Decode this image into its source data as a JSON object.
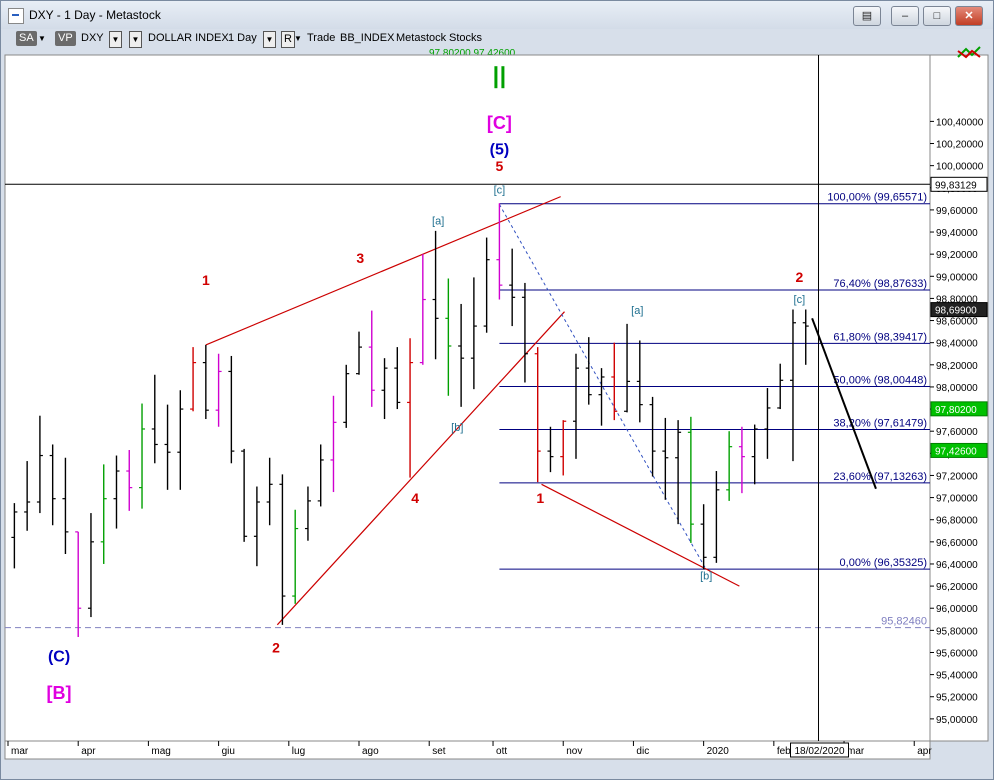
{
  "window": {
    "title": "DXY - 1 Day - Metastock",
    "minimize_label": "–",
    "restore_label": "□",
    "close_label": "✕",
    "help_label": "▤"
  },
  "toolbar": {
    "sa": "SA",
    "vp": "VP",
    "symbol": "DXY",
    "name": "DOLLAR INDEX",
    "period": "1 Day",
    "rmode": "R",
    "mode": "Trade",
    "datasource": "BB_INDEX",
    "vendor": "Metastock",
    "instrument": "Stocks",
    "ma_values": "97,80200  97,42600"
  },
  "colors": {
    "background": "#ffffff",
    "bar_black": "#000000",
    "bar_green": "#00a000",
    "bar_red": "#d00000",
    "bar_magenta": "#d000d0",
    "fib_line": "#000080",
    "trend_line": "#cc0000",
    "label_red": "#d00000",
    "label_blue": "#0000c0",
    "label_magenta": "#e000e0",
    "label_teal": "#207090",
    "label_green": "#00a000"
  },
  "chart_data": {
    "type": "candlestick",
    "title": "",
    "xlabel": "",
    "ylabel": "",
    "ylim": [
      94.8,
      101.0
    ],
    "x_ticks": [
      "mar",
      "apr",
      "mag",
      "giu",
      "lug",
      "ago",
      "set",
      "ott",
      "nov",
      "dic",
      "2020",
      "feb",
      "mar",
      "apr"
    ],
    "y_ticks": [
      "100,40000",
      "100,20000",
      "100,00000",
      "99,80000",
      "99,60000",
      "99,40000",
      "99,20000",
      "99,00000",
      "98,80000",
      "98,60000",
      "98,40000",
      "98,20000",
      "98,00000",
      "97,80000",
      "97,60000",
      "97,40000",
      "97,20000",
      "97,00000",
      "96,80000",
      "96,60000",
      "96,40000",
      "96,20000",
      "96,00000",
      "95,80000",
      "95,60000",
      "95,40000",
      "95,20000",
      "95,00000"
    ],
    "price_badges": [
      {
        "value": 99.83129,
        "text": "99,83129",
        "style": "box"
      },
      {
        "value": 98.699,
        "text": "98,69900",
        "style": "dark"
      },
      {
        "value": 97.802,
        "text": "97,80200",
        "style": "green"
      },
      {
        "value": 97.426,
        "text": "97,42600",
        "style": "green"
      }
    ],
    "cursor_date": "18/02/2020",
    "fib_levels": [
      {
        "pct": "100,00%",
        "value": 99.65571,
        "label": "100,00% (99,65571)"
      },
      {
        "pct": "76,40%",
        "value": 98.87633,
        "label": "76,40% (98,87633)"
      },
      {
        "pct": "61,80%",
        "value": 98.39417,
        "label": "61,80% (98,39417)"
      },
      {
        "pct": "50,00%",
        "value": 98.00448,
        "label": "50,00% (98,00448)"
      },
      {
        "pct": "38,20%",
        "value": 97.61479,
        "label": "38,20% (97,61479)"
      },
      {
        "pct": "23,60%",
        "value": 97.13263,
        "label": "23,60% (97,13263)"
      },
      {
        "pct": "0,00%",
        "value": 96.35325,
        "label": "0,00% (96,35325)"
      }
    ],
    "reference_lines": [
      {
        "value": 99.83129,
        "style": "solid"
      },
      {
        "value": 95.8246,
        "style": "dashed",
        "label": "95,82460"
      }
    ],
    "wave_labels": [
      {
        "text": "(C)",
        "date": 3.5,
        "value": 95.52,
        "color": "blue"
      },
      {
        "text": "[B]",
        "date": 3.5,
        "value": 95.18,
        "color": "magenta"
      },
      {
        "text": "1",
        "date": 15.0,
        "value": 98.92,
        "color": "red"
      },
      {
        "text": "2",
        "date": 20.5,
        "value": 95.6,
        "color": "red"
      },
      {
        "text": "3",
        "date": 27.1,
        "value": 99.12,
        "color": "red"
      },
      {
        "text": "4",
        "date": 31.4,
        "value": 96.95,
        "color": "red"
      },
      {
        "text": "[a]",
        "date": 33.2,
        "value": 99.47,
        "color": "teal"
      },
      {
        "text": "[b]",
        "date": 34.7,
        "value": 97.6,
        "color": "teal"
      },
      {
        "text": "[c]",
        "date": 38.0,
        "value": 99.75,
        "color": "teal"
      },
      {
        "text": "5",
        "date": 38.0,
        "value": 99.95,
        "color": "red"
      },
      {
        "text": "(5)",
        "date": 38.0,
        "value": 100.1,
        "color": "blue"
      },
      {
        "text": "[C]",
        "date": 38.0,
        "value": 100.33,
        "color": "magenta"
      },
      {
        "text": "1",
        "date": 41.2,
        "value": 96.95,
        "color": "red"
      },
      {
        "text": "[a]",
        "date": 48.8,
        "value": 98.66,
        "color": "teal"
      },
      {
        "text": "[b]",
        "date": 54.2,
        "value": 96.26,
        "color": "teal"
      },
      {
        "text": "2",
        "date": 61.5,
        "value": 98.95,
        "color": "red"
      },
      {
        "text": "[c]",
        "date": 61.5,
        "value": 98.76,
        "color": "teal"
      }
    ],
    "top_marker": {
      "date": 38.0,
      "color": "green"
    },
    "trend_lines": [
      {
        "from": [
          15.0,
          98.38
        ],
        "to": [
          42.8,
          99.72
        ]
      },
      {
        "from": [
          20.6,
          95.85
        ],
        "to": [
          43.1,
          98.68
        ]
      },
      {
        "from": [
          41.3,
          97.12
        ],
        "to": [
          56.8,
          96.2
        ]
      }
    ],
    "dashed_lines": [
      {
        "from": [
          38.0,
          99.65
        ],
        "to": [
          54.2,
          96.35
        ]
      }
    ],
    "projection_line": {
      "from": [
        62.5,
        98.62
      ],
      "to": [
        67.5,
        97.08
      ]
    },
    "cursor_line": {
      "date": 63.0
    },
    "n_bars": 63,
    "bars": [
      [
        96.64,
        96.95,
        96.36,
        96.87
      ],
      [
        96.87,
        97.33,
        96.7,
        96.96
      ],
      [
        96.96,
        97.74,
        96.86,
        97.38
      ],
      [
        97.38,
        97.48,
        96.75,
        96.99
      ],
      [
        96.99,
        97.36,
        96.49,
        96.69
      ],
      [
        96.69,
        96.69,
        95.74,
        96.0
      ],
      [
        96.0,
        96.86,
        95.92,
        96.6
      ],
      [
        96.6,
        97.3,
        96.4,
        96.99
      ],
      [
        96.99,
        97.38,
        96.72,
        97.24
      ],
      [
        97.24,
        97.43,
        96.88,
        97.09
      ],
      [
        97.09,
        97.85,
        96.9,
        97.62
      ],
      [
        97.62,
        98.11,
        97.31,
        97.48
      ],
      [
        97.48,
        97.84,
        97.07,
        97.41
      ],
      [
        97.41,
        97.97,
        97.07,
        97.8
      ],
      [
        97.8,
        98.36,
        97.78,
        98.22
      ],
      [
        98.22,
        98.38,
        97.71,
        97.79
      ],
      [
        97.79,
        98.3,
        97.64,
        98.14
      ],
      [
        98.14,
        98.28,
        97.31,
        97.42
      ],
      [
        97.42,
        97.44,
        96.6,
        96.65
      ],
      [
        96.65,
        97.1,
        96.38,
        96.96
      ],
      [
        96.96,
        97.36,
        96.75,
        97.12
      ],
      [
        97.12,
        97.21,
        95.85,
        96.11
      ],
      [
        96.11,
        96.89,
        96.04,
        96.72
      ],
      [
        96.72,
        97.1,
        96.61,
        96.97
      ],
      [
        96.97,
        97.48,
        96.92,
        97.34
      ],
      [
        97.34,
        97.92,
        97.05,
        97.68
      ],
      [
        97.68,
        98.2,
        97.63,
        98.12
      ],
      [
        98.12,
        98.5,
        98.11,
        98.36
      ],
      [
        98.36,
        98.69,
        97.82,
        97.97
      ],
      [
        97.97,
        98.26,
        97.71,
        98.17
      ],
      [
        98.17,
        98.36,
        97.8,
        97.86
      ],
      [
        97.86,
        98.44,
        97.18,
        98.22
      ],
      [
        98.22,
        99.2,
        98.2,
        98.79
      ],
      [
        98.79,
        99.41,
        98.25,
        98.62
      ],
      [
        98.62,
        98.98,
        97.92,
        98.37
      ],
      [
        98.37,
        98.75,
        97.82,
        98.26
      ],
      [
        98.26,
        98.99,
        97.98,
        98.55
      ],
      [
        98.55,
        99.35,
        98.49,
        99.15
      ],
      [
        99.15,
        99.66,
        98.79,
        98.92
      ],
      [
        98.92,
        99.25,
        98.55,
        98.81
      ],
      [
        98.81,
        98.94,
        98.04,
        98.3
      ],
      [
        98.3,
        98.36,
        97.14,
        97.42
      ],
      [
        97.42,
        97.64,
        97.23,
        97.37
      ],
      [
        97.37,
        97.7,
        97.2,
        97.69
      ],
      [
        97.69,
        98.3,
        97.35,
        98.17
      ],
      [
        98.17,
        98.45,
        97.84,
        97.93
      ],
      [
        97.93,
        98.17,
        97.65,
        98.09
      ],
      [
        98.09,
        98.4,
        97.7,
        97.78
      ],
      [
        97.78,
        98.57,
        97.77,
        98.05
      ],
      [
        98.05,
        98.42,
        97.68,
        97.84
      ],
      [
        97.84,
        97.91,
        97.19,
        97.42
      ],
      [
        97.42,
        97.72,
        96.98,
        97.36
      ],
      [
        97.36,
        97.7,
        96.76,
        97.59
      ],
      [
        97.59,
        97.73,
        96.59,
        96.76
      ],
      [
        96.76,
        96.94,
        96.35,
        96.46
      ],
      [
        96.46,
        97.24,
        96.41,
        97.07
      ],
      [
        97.07,
        97.6,
        96.97,
        97.46
      ],
      [
        97.46,
        97.64,
        97.04,
        97.37
      ],
      [
        97.37,
        97.66,
        97.12,
        97.62
      ],
      [
        97.62,
        97.99,
        97.35,
        97.81
      ],
      [
        97.81,
        98.21,
        97.8,
        98.06
      ],
      [
        98.06,
        98.7,
        97.33,
        98.58
      ],
      [
        98.58,
        98.7,
        98.2,
        98.55
      ]
    ],
    "bar_colors": [
      "black",
      "black",
      "black",
      "black",
      "black",
      "magenta",
      "black",
      "green",
      "black",
      "magenta",
      "green",
      "black",
      "black",
      "black",
      "red",
      "black",
      "magenta",
      "black",
      "black",
      "black",
      "black",
      "black",
      "green",
      "black",
      "black",
      "magenta",
      "black",
      "black",
      "magenta",
      "black",
      "black",
      "red",
      "magenta",
      "black",
      "green",
      "black",
      "black",
      "black",
      "magenta",
      "black",
      "black",
      "red",
      "black",
      "red",
      "black",
      "black",
      "black",
      "red",
      "black",
      "black",
      "black",
      "black",
      "black",
      "green",
      "black",
      "black",
      "green",
      "magenta",
      "black",
      "black",
      "black",
      "black",
      "black"
    ]
  }
}
